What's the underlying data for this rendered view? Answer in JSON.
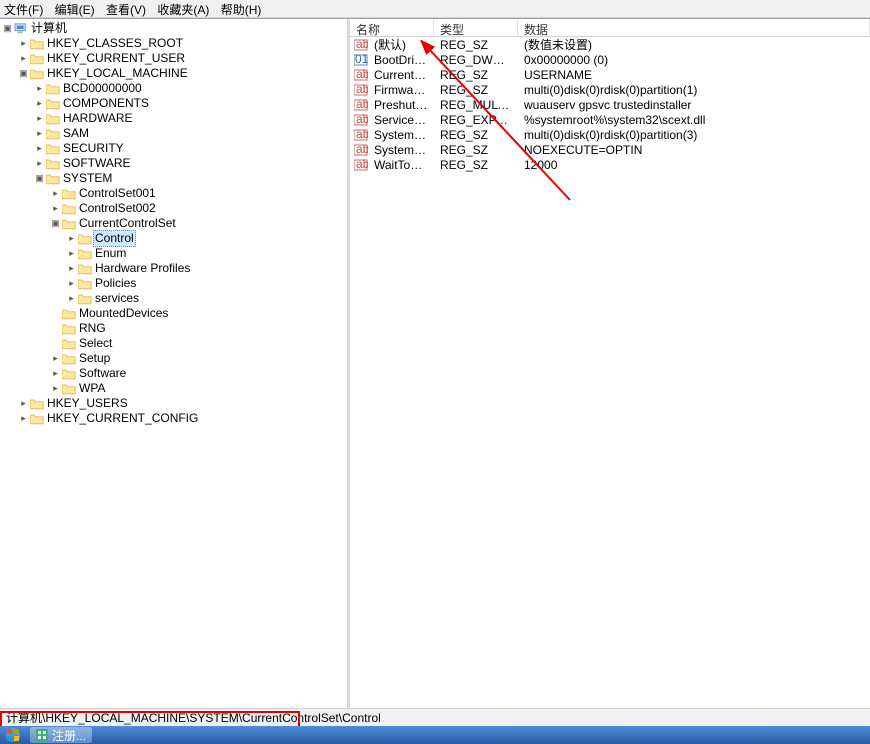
{
  "menu": {
    "file": "文件(F)",
    "edit": "编辑(E)",
    "view": "查看(V)",
    "fav": "收藏夹(A)",
    "help": "帮助(H)"
  },
  "tree_root": "计算机",
  "hk": {
    "hkcr": "HKEY_CLASSES_ROOT",
    "hkcu": "HKEY_CURRENT_USER",
    "hklm": "HKEY_LOCAL_MACHINE",
    "hku": "HKEY_USERS",
    "hkcc": "HKEY_CURRENT_CONFIG"
  },
  "hklm_children": {
    "bcd": "BCD00000000",
    "comp": "COMPONENTS",
    "hw": "HARDWARE",
    "sam": "SAM",
    "sec": "SECURITY",
    "sw": "SOFTWARE",
    "sys": "SYSTEM"
  },
  "system_children": {
    "ccs1": "ControlSet001",
    "ccs2": "ControlSet002",
    "ccs": "CurrentControlSet",
    "md": "MountedDevices",
    "rng": "RNG",
    "sel": "Select",
    "setup": "Setup",
    "sw2": "Software",
    "wpa": "WPA"
  },
  "ccs_children": {
    "ctrl": "Control",
    "enum": "Enum",
    "hp": "Hardware Profiles",
    "pol": "Policies",
    "svc": "services"
  },
  "cols": {
    "name": "名称",
    "type": "类型",
    "data": "数据"
  },
  "values": [
    {
      "n": "(默认)",
      "t": "REG_SZ",
      "d": "(数值未设置)",
      "k": "s"
    },
    {
      "n": "BootDriverFlags",
      "t": "REG_DWORD",
      "d": "0x00000000 (0)",
      "k": "b"
    },
    {
      "n": "CurrentUser",
      "t": "REG_SZ",
      "d": "USERNAME",
      "k": "s"
    },
    {
      "n": "FirmwareBootD...",
      "t": "REG_SZ",
      "d": "multi(0)disk(0)rdisk(0)partition(1)",
      "k": "s"
    },
    {
      "n": "PreshutdownOr...",
      "t": "REG_MULTI_SZ",
      "d": "wuauserv gpsvc trustedinstaller",
      "k": "s"
    },
    {
      "n": "ServiceControl...",
      "t": "REG_EXPAND_SZ",
      "d": "%systemroot%\\system32\\scext.dll",
      "k": "s"
    },
    {
      "n": "SystemBootDev...",
      "t": "REG_SZ",
      "d": "multi(0)disk(0)rdisk(0)partition(3)",
      "k": "s"
    },
    {
      "n": "SystemStartOpt...",
      "t": "REG_SZ",
      "d": " NOEXECUTE=OPTIN",
      "k": "s"
    },
    {
      "n": "WaitToKillServic...",
      "t": "REG_SZ",
      "d": "12000",
      "k": "s"
    }
  ],
  "status_path": "计算机\\HKEY_LOCAL_MACHINE\\SYSTEM\\CurrentControlSet\\Control",
  "taskbar_item": "注册..."
}
